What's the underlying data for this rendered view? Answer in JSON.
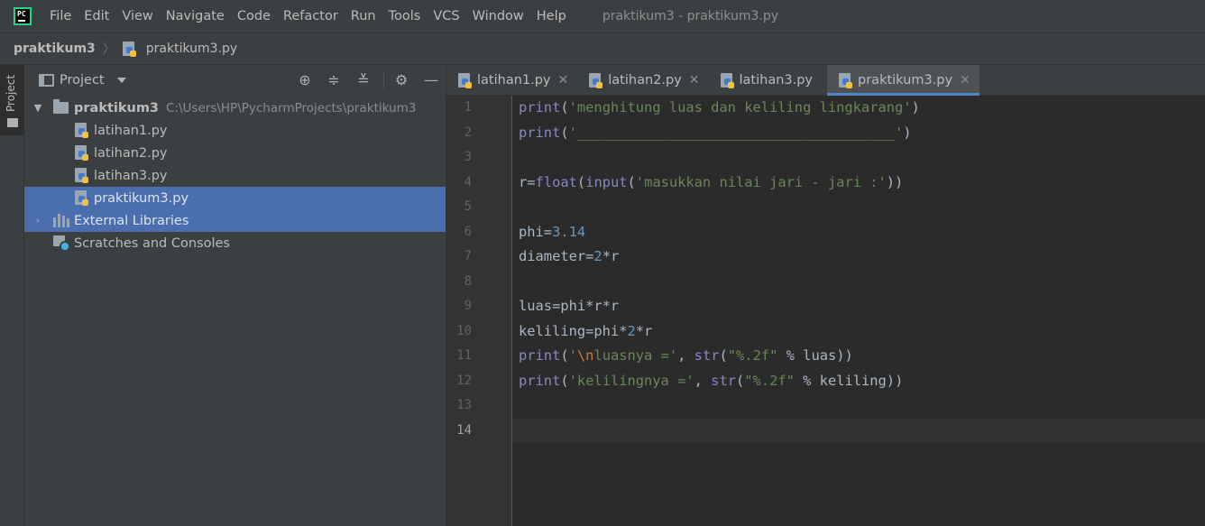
{
  "menubar": {
    "items": [
      "File",
      "Edit",
      "View",
      "Navigate",
      "Code",
      "Refactor",
      "Run",
      "Tools",
      "VCS",
      "Window",
      "Help"
    ],
    "window_title": "praktikum3 - praktikum3.py"
  },
  "breadcrumb": {
    "project": "praktikum3",
    "separator": "〉",
    "file": "praktikum3.py"
  },
  "tool_strip": {
    "project_label": "Project"
  },
  "project_panel": {
    "title": "Project",
    "root": {
      "name": "praktikum3",
      "path": "C:\\Users\\HP\\PycharmProjects\\praktikum3"
    },
    "files": [
      "latihan1.py",
      "latihan2.py",
      "latihan3.py",
      "praktikum3.py"
    ],
    "selected_file": "praktikum3.py",
    "external_libraries": "External Libraries",
    "scratches": "Scratches and Consoles"
  },
  "tabs": [
    {
      "label": "latihan1.py",
      "active": false
    },
    {
      "label": "latihan2.py",
      "active": false
    },
    {
      "label": "latihan3.py",
      "active": false
    },
    {
      "label": "praktikum3.py",
      "active": true
    }
  ],
  "editor": {
    "current_line": 14,
    "line_numbers": [
      "1",
      "2",
      "3",
      "4",
      "5",
      "6",
      "7",
      "8",
      "9",
      "10",
      "11",
      "12",
      "13",
      "14"
    ],
    "code": {
      "l1": {
        "fn": "print",
        "p1": "(",
        "s1": "'menghitung luas dan keliling lingkarang'",
        "p2": ")"
      },
      "l2": {
        "fn": "print",
        "p1": "(",
        "s1": "'______________________________________'",
        "p2": ")"
      },
      "l4": {
        "a": "r=",
        "fn1": "float",
        "b": "(",
        "fn2": "input",
        "c": "(",
        "s1": "'masukkan nilai jari - jari :'",
        "d": "))"
      },
      "l6": {
        "a": "phi=",
        "n1": "3.14"
      },
      "l7": {
        "a": "diameter=",
        "n1": "2",
        "b": "*r"
      },
      "l9": {
        "a": "luas=phi*r*r"
      },
      "l10": {
        "a": "keliling=phi*",
        "n1": "2",
        "b": "*r"
      },
      "l11": {
        "fn1": "print",
        "a": "(",
        "s1": "'",
        "esc": "\\n",
        "s2": "luasnya ='",
        "b": ", ",
        "fn2": "str",
        "c": "(",
        "s3": "\"%.2f\"",
        "d": " % luas))"
      },
      "l12": {
        "fn1": "print",
        "a": "(",
        "s1": "'kelilingnya ='",
        "b": ", ",
        "fn2": "str",
        "c": "(",
        "s2": "\"%.2f\"",
        "d": " % keliling))"
      }
    }
  }
}
